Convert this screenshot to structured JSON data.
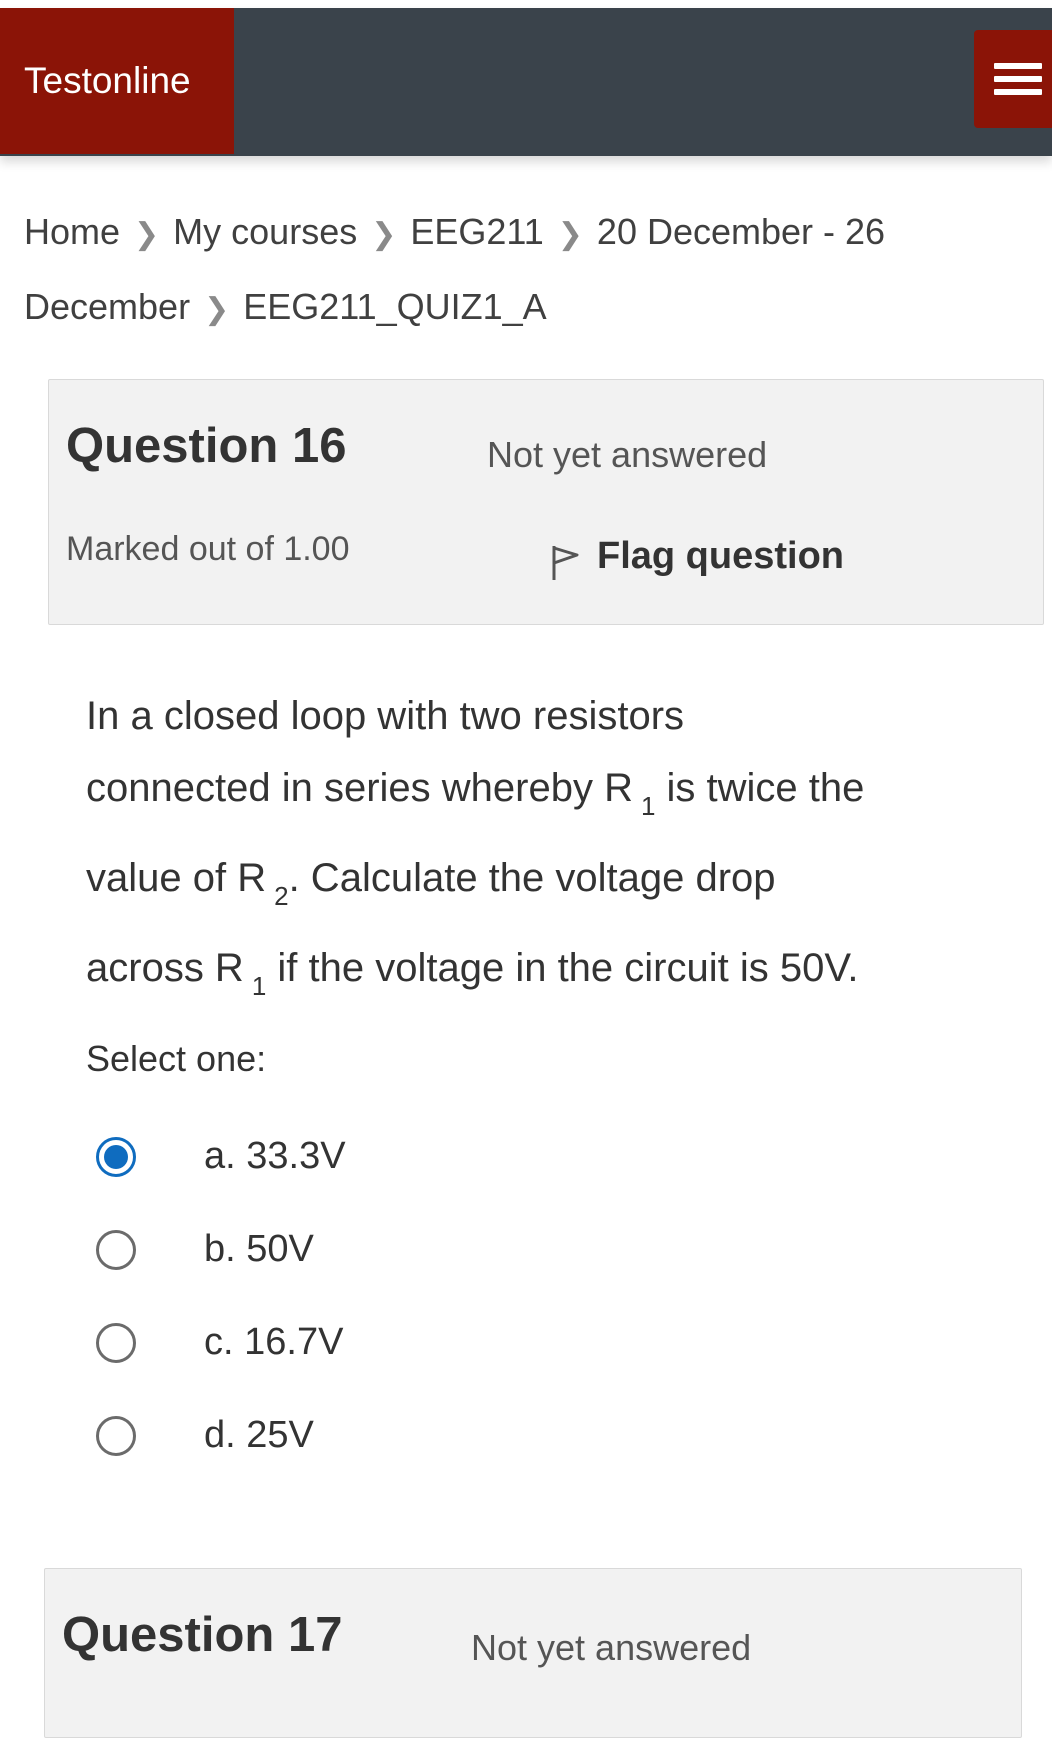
{
  "header": {
    "brand": "Testonline",
    "menu_icon": "hamburger-icon"
  },
  "breadcrumb": {
    "items": [
      "Home",
      "My courses",
      "EEG211",
      "20 December - 26",
      "December",
      "EEG211_QUIZ1_A"
    ],
    "separator_icon": "chevron-right-icon"
  },
  "question16": {
    "number_label": "Question",
    "number": "16",
    "state": "Not yet answered",
    "grade": "Marked out of 1.00",
    "flag_label": "Flag question",
    "flag_icon": "flag-icon",
    "text": {
      "line1": "In a closed loop with two resistors",
      "line2_a": "connected in series whereby R",
      "line2_sub": "1",
      "line2_b": " is twice the",
      "line3_a": "value of R",
      "line3_sub": "2",
      "line3_b": ". Calculate the voltage drop",
      "line4_a": "across R",
      "line4_sub": "1",
      "line4_b": " if the voltage in the circuit is 50V."
    },
    "prompt": "Select one:",
    "options": [
      {
        "label": "a. 33.3V",
        "selected": true
      },
      {
        "label": "b. 50V",
        "selected": false
      },
      {
        "label": "c. 16.7V",
        "selected": false
      },
      {
        "label": "d. 25V",
        "selected": false
      }
    ]
  },
  "question17": {
    "number_label": "Question",
    "number": "17",
    "state": "Not yet answered"
  },
  "colors": {
    "brand_red": "#8b1407",
    "navbar": "#3a434b",
    "radio_selected": "#0f6cbf"
  }
}
